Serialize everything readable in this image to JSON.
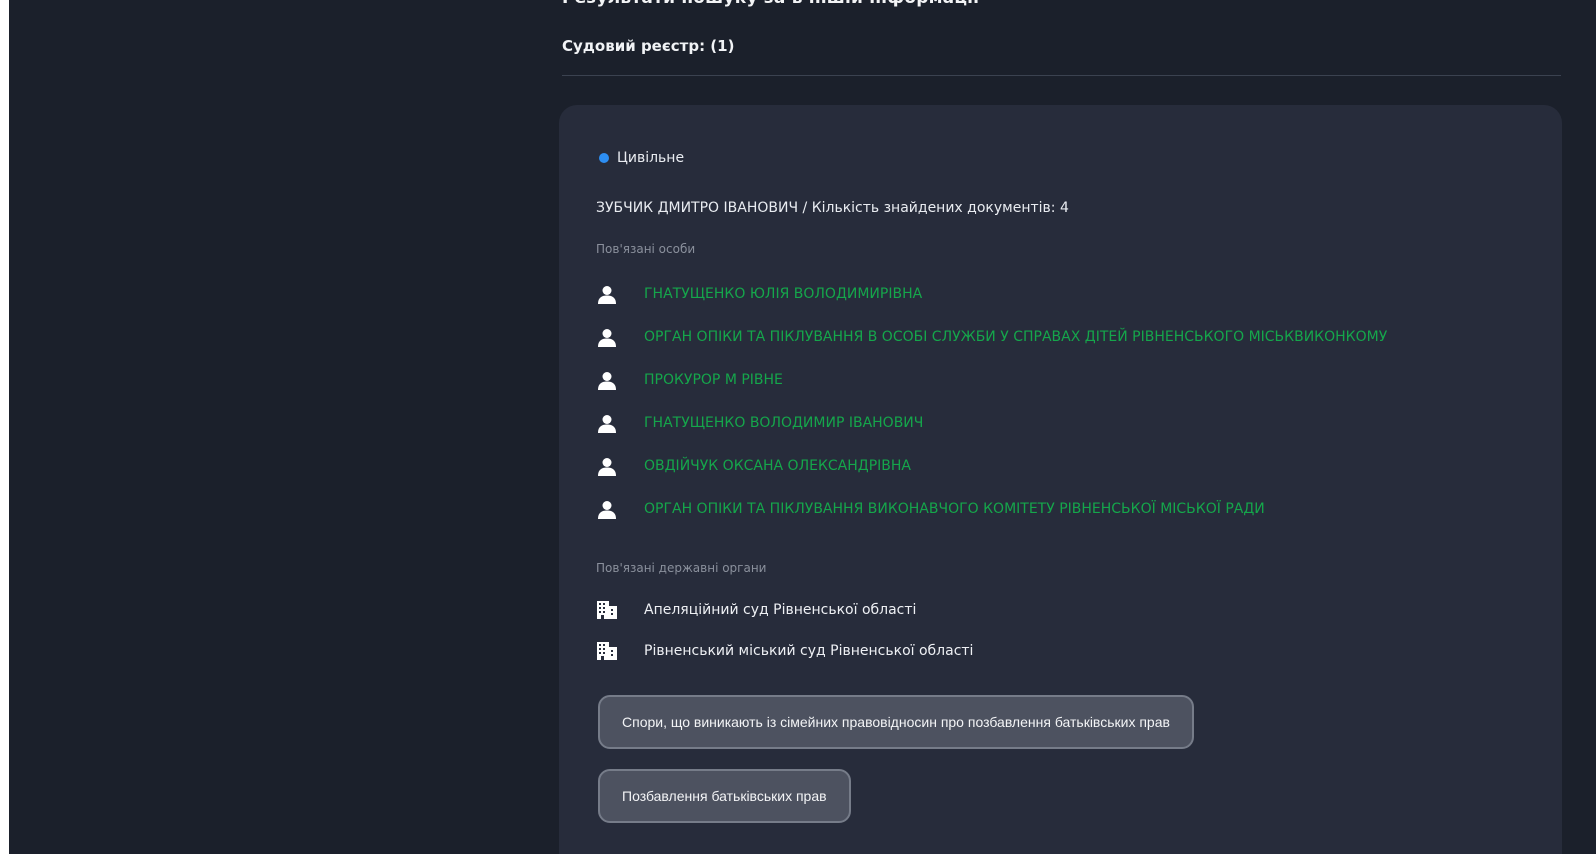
{
  "header": {
    "results_heading": "Результати пошуку за в іншій інформації",
    "registry_title": "Судовий реєстр: (1)"
  },
  "case": {
    "type": "Цивільне",
    "type_dot_color": "#2d8ef2",
    "name": "ЗУБЧИК ДМИТРО ІВАНОВИЧ",
    "separator": " / ",
    "docs_label": "Кількість знайдених документів: 4",
    "related_persons_label": "Пов'язані особи",
    "related_persons": [
      {
        "name": "ГНАТУЩЕНКО ЮЛІЯ ВОЛОДИМИРІВНА",
        "icon": "person-icon"
      },
      {
        "name": "ОРГАН ОПІКИ ТА ПІКЛУВАННЯ В ОСОБІ СЛУЖБИ У СПРАВАХ ДІТЕЙ РІВНЕНСЬКОГО МІСЬКВИКОНКОМУ",
        "icon": "person-icon"
      },
      {
        "name": "ПРОКУРОР М РІВНЕ",
        "icon": "person-icon"
      },
      {
        "name": "ГНАТУЩЕНКО ВОЛОДИМИР ІВАНОВИЧ",
        "icon": "person-icon"
      },
      {
        "name": "ОВДІЙЧУК ОКСАНА ОЛЕКСАНДРІВНА",
        "icon": "person-icon"
      },
      {
        "name": "ОРГАН ОПІКИ ТА ПІКЛУВАННЯ ВИКОНАВЧОГО КОМІТЕТУ РІВНЕНСЬКОЇ МІСЬКОЇ РАДИ",
        "icon": "person-icon"
      }
    ],
    "related_bodies_label": "Пов'язані державні органи",
    "related_bodies": [
      {
        "name": "Апеляційний суд Рівненської області",
        "icon": "building-icon"
      },
      {
        "name": "Рівненський міський суд Рівненської області",
        "icon": "building-icon"
      }
    ],
    "tags": [
      "Спори, що виникають із сімейних правовідносин про позбавлення батьківських прав",
      "Позбавлення батьківських прав"
    ]
  },
  "colors": {
    "background": "#1b202b",
    "card": "#272c3b",
    "link_green": "#15a64b",
    "muted": "#8a909c"
  }
}
